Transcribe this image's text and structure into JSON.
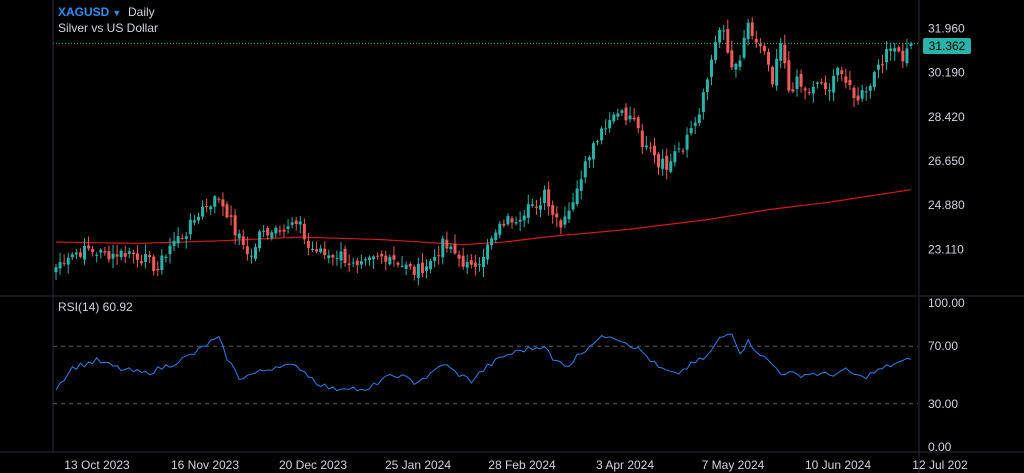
{
  "header": {
    "symbol": "XAGUSD",
    "timeframe": "Daily",
    "description": "Silver vs US Dollar"
  },
  "price_badge": "31.362",
  "rsi_label": "RSI(14) 60.92",
  "colors": {
    "background": "#000000",
    "up_candle": "#2ab3a8",
    "down_candle": "#ef5b5b",
    "moving_average": "#d11a1a",
    "rsi_line": "#2f7fe8",
    "symbol_link": "#2f8cf5"
  },
  "chart_data": [
    {
      "type": "candlestick",
      "title": "XAGUSD Daily",
      "y_ticks": [
        "31.960",
        "30.190",
        "28.420",
        "26.650",
        "24.880",
        "23.110"
      ],
      "ylim": [
        21.4,
        32.9
      ],
      "x_ticks": [
        "13 Oct 2023",
        "16 Nov 2023",
        "20 Dec 2023",
        "25 Jan 2024",
        "28 Feb 2024",
        "3 Apr 2024",
        "7 May 2024",
        "10 Jun 2024",
        "12 Jul 202"
      ],
      "last_price": 31.362,
      "price_line": 31.362,
      "anchors": [
        {
          "i": 0,
          "v": 22.4
        },
        {
          "i": 3,
          "v": 22.9
        },
        {
          "i": 8,
          "v": 23.1
        },
        {
          "i": 12,
          "v": 22.9
        },
        {
          "i": 18,
          "v": 23.0
        },
        {
          "i": 22,
          "v": 22.7
        },
        {
          "i": 25,
          "v": 22.3
        },
        {
          "i": 28,
          "v": 23.3
        },
        {
          "i": 32,
          "v": 23.8
        },
        {
          "i": 36,
          "v": 24.8
        },
        {
          "i": 40,
          "v": 25.2
        },
        {
          "i": 42,
          "v": 24.6
        },
        {
          "i": 44,
          "v": 23.8
        },
        {
          "i": 46,
          "v": 23.3
        },
        {
          "i": 48,
          "v": 22.8
        },
        {
          "i": 50,
          "v": 23.7
        },
        {
          "i": 54,
          "v": 24.0
        },
        {
          "i": 58,
          "v": 24.1
        },
        {
          "i": 60,
          "v": 24.0
        },
        {
          "i": 62,
          "v": 23.2
        },
        {
          "i": 66,
          "v": 22.9
        },
        {
          "i": 70,
          "v": 22.9
        },
        {
          "i": 74,
          "v": 22.3
        },
        {
          "i": 78,
          "v": 22.7
        },
        {
          "i": 82,
          "v": 22.9
        },
        {
          "i": 85,
          "v": 22.5
        },
        {
          "i": 88,
          "v": 22.2
        },
        {
          "i": 92,
          "v": 22.6
        },
        {
          "i": 95,
          "v": 23.3
        },
        {
          "i": 98,
          "v": 22.9
        },
        {
          "i": 102,
          "v": 22.3
        },
        {
          "i": 106,
          "v": 23.2
        },
        {
          "i": 110,
          "v": 24.2
        },
        {
          "i": 114,
          "v": 24.5
        },
        {
          "i": 116,
          "v": 24.9
        },
        {
          "i": 118,
          "v": 24.6
        },
        {
          "i": 120,
          "v": 25.5
        },
        {
          "i": 122,
          "v": 24.6
        },
        {
          "i": 124,
          "v": 24.2
        },
        {
          "i": 126,
          "v": 24.8
        },
        {
          "i": 128,
          "v": 25.4
        },
        {
          "i": 130,
          "v": 26.8
        },
        {
          "i": 132,
          "v": 27.3
        },
        {
          "i": 134,
          "v": 28.0
        },
        {
          "i": 136,
          "v": 28.3
        },
        {
          "i": 138,
          "v": 28.8
        },
        {
          "i": 140,
          "v": 28.3
        },
        {
          "i": 142,
          "v": 28.4
        },
        {
          "i": 144,
          "v": 27.1
        },
        {
          "i": 146,
          "v": 27.3
        },
        {
          "i": 148,
          "v": 26.6
        },
        {
          "i": 150,
          "v": 26.5
        },
        {
          "i": 152,
          "v": 27.2
        },
        {
          "i": 154,
          "v": 27.3
        },
        {
          "i": 156,
          "v": 28.0
        },
        {
          "i": 158,
          "v": 28.5
        },
        {
          "i": 160,
          "v": 29.9
        },
        {
          "i": 162,
          "v": 31.6
        },
        {
          "i": 164,
          "v": 31.8
        },
        {
          "i": 166,
          "v": 30.2
        },
        {
          "i": 168,
          "v": 30.7
        },
        {
          "i": 170,
          "v": 32.0
        },
        {
          "i": 172,
          "v": 31.4
        },
        {
          "i": 174,
          "v": 30.9
        },
        {
          "i": 176,
          "v": 29.7
        },
        {
          "i": 178,
          "v": 31.3
        },
        {
          "i": 180,
          "v": 29.5
        },
        {
          "i": 182,
          "v": 29.8
        },
        {
          "i": 184,
          "v": 29.4
        },
        {
          "i": 186,
          "v": 29.5
        },
        {
          "i": 188,
          "v": 29.8
        },
        {
          "i": 190,
          "v": 29.3
        },
        {
          "i": 192,
          "v": 30.6
        },
        {
          "i": 194,
          "v": 29.8
        },
        {
          "i": 196,
          "v": 29.1
        },
        {
          "i": 198,
          "v": 29.4
        },
        {
          "i": 200,
          "v": 29.8
        },
        {
          "i": 202,
          "v": 30.6
        },
        {
          "i": 204,
          "v": 30.9
        },
        {
          "i": 206,
          "v": 31.4
        },
        {
          "i": 208,
          "v": 30.8
        },
        {
          "i": 210,
          "v": 31.36
        }
      ],
      "moving_average": [
        {
          "i": 0,
          "v": 23.4
        },
        {
          "i": 20,
          "v": 23.35
        },
        {
          "i": 40,
          "v": 23.45
        },
        {
          "i": 60,
          "v": 23.6
        },
        {
          "i": 80,
          "v": 23.5
        },
        {
          "i": 100,
          "v": 23.3
        },
        {
          "i": 110,
          "v": 23.4
        },
        {
          "i": 120,
          "v": 23.6
        },
        {
          "i": 140,
          "v": 23.9
        },
        {
          "i": 160,
          "v": 24.3
        },
        {
          "i": 175,
          "v": 24.7
        },
        {
          "i": 190,
          "v": 25.0
        },
        {
          "i": 210,
          "v": 25.5
        }
      ]
    },
    {
      "type": "line",
      "title": "RSI(14) 60.92",
      "y_ticks": [
        "100.00",
        "70.00",
        "30.00",
        "0.00"
      ],
      "ylim": [
        0,
        100
      ],
      "levels": [
        70,
        30
      ],
      "last_value": 60.92,
      "anchors": [
        {
          "i": 0,
          "v": 41
        },
        {
          "i": 4,
          "v": 55
        },
        {
          "i": 10,
          "v": 60
        },
        {
          "i": 16,
          "v": 54
        },
        {
          "i": 22,
          "v": 51
        },
        {
          "i": 28,
          "v": 57
        },
        {
          "i": 34,
          "v": 65
        },
        {
          "i": 38,
          "v": 73
        },
        {
          "i": 40,
          "v": 75
        },
        {
          "i": 42,
          "v": 62
        },
        {
          "i": 45,
          "v": 48
        },
        {
          "i": 50,
          "v": 52
        },
        {
          "i": 55,
          "v": 57
        },
        {
          "i": 60,
          "v": 55
        },
        {
          "i": 64,
          "v": 45
        },
        {
          "i": 68,
          "v": 40
        },
        {
          "i": 72,
          "v": 42
        },
        {
          "i": 76,
          "v": 38
        },
        {
          "i": 80,
          "v": 47
        },
        {
          "i": 84,
          "v": 50
        },
        {
          "i": 88,
          "v": 45
        },
        {
          "i": 92,
          "v": 50
        },
        {
          "i": 95,
          "v": 58
        },
        {
          "i": 98,
          "v": 52
        },
        {
          "i": 102,
          "v": 46
        },
        {
          "i": 106,
          "v": 56
        },
        {
          "i": 110,
          "v": 63
        },
        {
          "i": 114,
          "v": 67
        },
        {
          "i": 118,
          "v": 69
        },
        {
          "i": 120,
          "v": 71
        },
        {
          "i": 122,
          "v": 60
        },
        {
          "i": 126,
          "v": 57
        },
        {
          "i": 128,
          "v": 63
        },
        {
          "i": 132,
          "v": 73
        },
        {
          "i": 136,
          "v": 78
        },
        {
          "i": 140,
          "v": 73
        },
        {
          "i": 144,
          "v": 66
        },
        {
          "i": 148,
          "v": 55
        },
        {
          "i": 152,
          "v": 50
        },
        {
          "i": 156,
          "v": 57
        },
        {
          "i": 160,
          "v": 63
        },
        {
          "i": 163,
          "v": 75
        },
        {
          "i": 166,
          "v": 80
        },
        {
          "i": 168,
          "v": 66
        },
        {
          "i": 170,
          "v": 73
        },
        {
          "i": 174,
          "v": 62
        },
        {
          "i": 178,
          "v": 52
        },
        {
          "i": 182,
          "v": 50
        },
        {
          "i": 186,
          "v": 51
        },
        {
          "i": 190,
          "v": 50
        },
        {
          "i": 194,
          "v": 53
        },
        {
          "i": 198,
          "v": 48
        },
        {
          "i": 202,
          "v": 53
        },
        {
          "i": 206,
          "v": 58
        },
        {
          "i": 208,
          "v": 59
        },
        {
          "i": 210,
          "v": 60.92
        }
      ]
    }
  ]
}
